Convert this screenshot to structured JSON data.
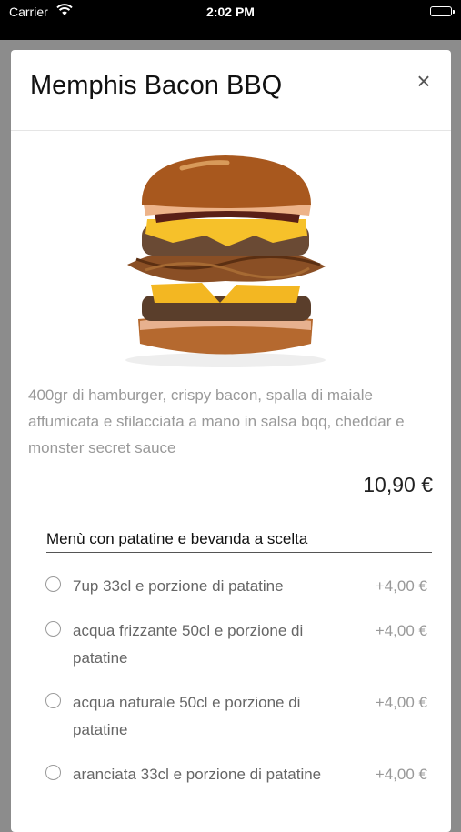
{
  "status_bar": {
    "carrier": "Carrier",
    "time": "2:02 PM"
  },
  "modal": {
    "title": "Memphis Bacon BBQ",
    "close_label": "×",
    "description": "400gr di hamburger, crispy bacon, spalla di maiale affumicata e sfilacciata a mano in salsa bqq, cheddar e monster secret sauce",
    "price": "10,90 €",
    "option_group": {
      "title": "Menù con patatine e bevanda a scelta",
      "options": [
        {
          "label": "7up 33cl e porzione di patatine",
          "price": "+4,00 €"
        },
        {
          "label": "acqua frizzante 50cl e porzione di patatine",
          "price": "+4,00 €"
        },
        {
          "label": "acqua naturale 50cl e porzione di patatine",
          "price": "+4,00 €"
        },
        {
          "label": "aranciata 33cl e porzione di patatine",
          "price": "+4,00 €"
        }
      ]
    }
  },
  "colors": {
    "overlay": "#8c8c8c",
    "description_text": "#999999",
    "option_text": "#666666"
  }
}
